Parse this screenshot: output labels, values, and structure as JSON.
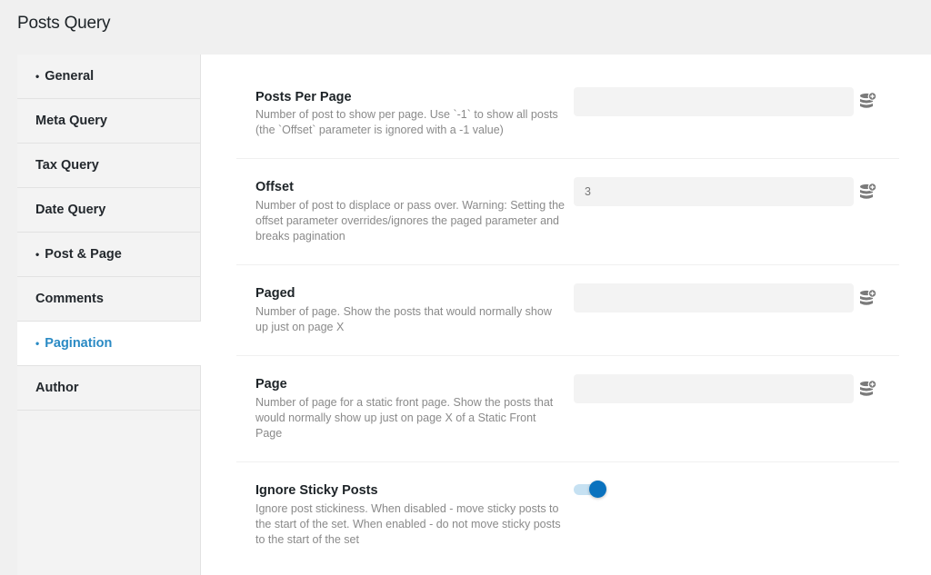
{
  "header": {
    "title": "Posts Query"
  },
  "sidebar": {
    "items": [
      {
        "label": "General",
        "bullet": "•",
        "active": false
      },
      {
        "label": "Meta Query",
        "bullet": "",
        "active": false
      },
      {
        "label": "Tax Query",
        "bullet": "",
        "active": false
      },
      {
        "label": "Date Query",
        "bullet": "",
        "active": false
      },
      {
        "label": "Post & Page",
        "bullet": "•",
        "active": false
      },
      {
        "label": "Comments",
        "bullet": "",
        "active": false
      },
      {
        "label": "Pagination",
        "bullet": "•",
        "active": true
      },
      {
        "label": "Author",
        "bullet": "",
        "active": false
      }
    ]
  },
  "fields": {
    "posts_per_page": {
      "label": "Posts Per Page",
      "description": "Number of post to show per page. Use `-1` to show all posts (the `Offset` parameter is ignored with a -1 value)",
      "value": "",
      "icon": "database-add-icon"
    },
    "offset": {
      "label": "Offset",
      "description": "Number of post to displace or pass over. Warning: Setting the offset parameter overrides/ignores the paged parameter and breaks pagination",
      "value": "3",
      "icon": "database-add-icon"
    },
    "paged": {
      "label": "Paged",
      "description": "Number of page. Show the posts that would normally show up just on page X",
      "value": "",
      "icon": "database-add-icon"
    },
    "page": {
      "label": "Page",
      "description": "Number of page for a static front page. Show the posts that would normally show up just on page X of a Static Front Page",
      "value": "",
      "icon": "database-add-icon"
    },
    "ignore_sticky_posts": {
      "label": "Ignore Sticky Posts",
      "description": "Ignore post stickiness. When disabled - move sticky posts to the start of the set. When enabled - do not move sticky posts to the start of the set",
      "enabled": true
    }
  },
  "colors": {
    "accent": "#2a8ac4",
    "toggle_on": "#0a72be",
    "toggle_track": "#c6e1f2",
    "icon": "#7a7a7a"
  }
}
